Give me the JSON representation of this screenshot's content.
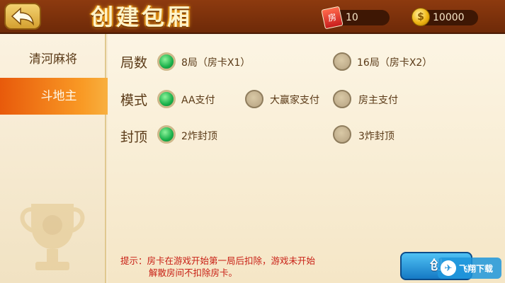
{
  "header": {
    "title": "创建包厢",
    "room_cards": "10",
    "room_card_icon_char": "房",
    "coins": "10000",
    "coin_icon_char": "$"
  },
  "sidebar": {
    "items": [
      {
        "label": "清河麻将",
        "selected": false
      },
      {
        "label": "斗地主",
        "selected": true
      }
    ]
  },
  "options": {
    "rounds": {
      "label": "局数",
      "choices": [
        {
          "label": "8局（房卡X1）",
          "selected": true
        },
        {
          "label": "16局（房卡X2）",
          "selected": false
        }
      ]
    },
    "mode": {
      "label": "模式",
      "choices": [
        {
          "label": "AA支付",
          "selected": true
        },
        {
          "label": "大赢家支付",
          "selected": false
        },
        {
          "label": "房主支付",
          "selected": false
        }
      ]
    },
    "cap": {
      "label": "封顶",
      "choices": [
        {
          "label": "2炸封顶",
          "selected": true
        },
        {
          "label": "3炸封顶",
          "selected": false
        }
      ]
    }
  },
  "hint": {
    "line1": "提示：房卡在游戏开始第一局后扣除，游戏未开始",
    "line2": "解散房间不扣除房卡。"
  },
  "create_button": {
    "label": "创"
  },
  "watermark": {
    "text": "飞翔下载"
  },
  "colors": {
    "header_bg": "#7a300b",
    "selected_tab": "#f08a1c",
    "radio_on": "#19b04a",
    "hint_text": "#c81e14",
    "create_button": "#2a9ee0"
  }
}
